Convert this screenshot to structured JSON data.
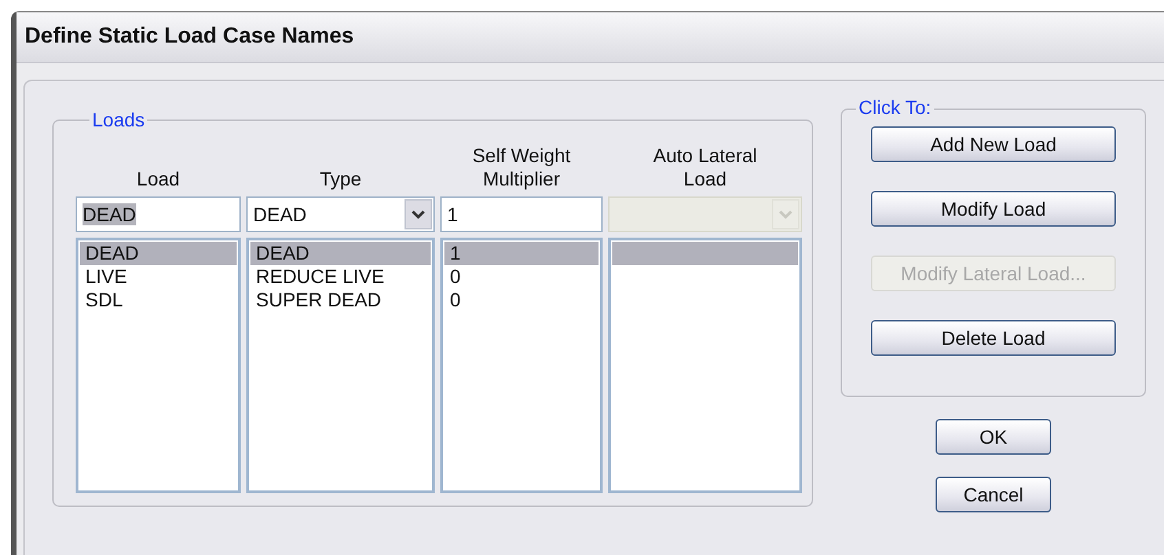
{
  "window": {
    "title": "Define Static Load Case Names"
  },
  "loads_group": {
    "label": "Loads",
    "columns": [
      "Load",
      "Type",
      "Self Weight Multiplier",
      "Auto Lateral Load"
    ],
    "edit_row": {
      "load": {
        "value": "DEAD",
        "text_selected": true
      },
      "type": {
        "value": "DEAD",
        "disabled": false
      },
      "multiplier": {
        "value": "1"
      },
      "auto_lateral": {
        "disabled": true
      }
    },
    "rows": [
      {
        "load": "DEAD",
        "type": "DEAD",
        "multiplier": "1",
        "selected": true
      },
      {
        "load": "LIVE",
        "type": "REDUCE LIVE",
        "multiplier": "0",
        "selected": false
      },
      {
        "load": "SDL",
        "type": "SUPER DEAD",
        "multiplier": "0",
        "selected": false
      }
    ]
  },
  "click_to_group": {
    "label": "Click To:",
    "buttons": [
      {
        "label": "Add New Load",
        "disabled": false
      },
      {
        "label": "Modify Load",
        "disabled": false
      },
      {
        "label": "Modify Lateral Load...",
        "disabled": true
      },
      {
        "label": "Delete Load",
        "disabled": false
      }
    ]
  },
  "dialog_buttons": [
    {
      "label": "OK",
      "disabled": false
    },
    {
      "label": "Cancel",
      "disabled": false
    }
  ]
}
